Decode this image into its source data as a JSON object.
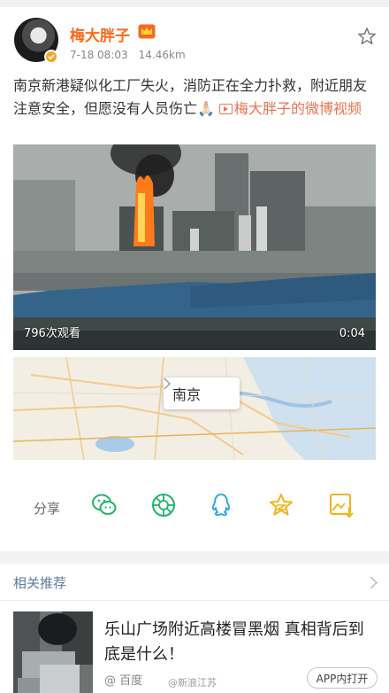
{
  "post": {
    "username": "梅大胖子",
    "date": "7-18 08:03",
    "distance": "14.46km",
    "text_main": "南京新港疑似化工厂失火，消防正在全力扑救，附近朋友注意安全，但愿没有人员伤亡🙏🏻 ",
    "link_text": "梅大胖子的微博视频"
  },
  "video": {
    "views": "796次观看",
    "duration": "0:04"
  },
  "map": {
    "location": "南京"
  },
  "share": {
    "label": "分享",
    "icons": [
      "wechat-icon",
      "moments-icon",
      "qq-icon",
      "qzone-icon",
      "save-image-icon"
    ],
    "colors": {
      "wechat": "#22b36b",
      "moments": "#22b36b",
      "qq": "#2aa9e8",
      "qzone": "#f3b31b",
      "save": "#f3b31b"
    }
  },
  "related": {
    "title": "相关推荐",
    "article": {
      "title": "乐山广场附近高楼冒黑烟 真相背后到底是什么！",
      "source": "@ 百度",
      "watermark": "@新浪江苏",
      "app_button": "APP内打开"
    }
  },
  "colors": {
    "accent": "#f86b1d",
    "link": "#eb7350",
    "related_title": "#5d7a9b"
  }
}
